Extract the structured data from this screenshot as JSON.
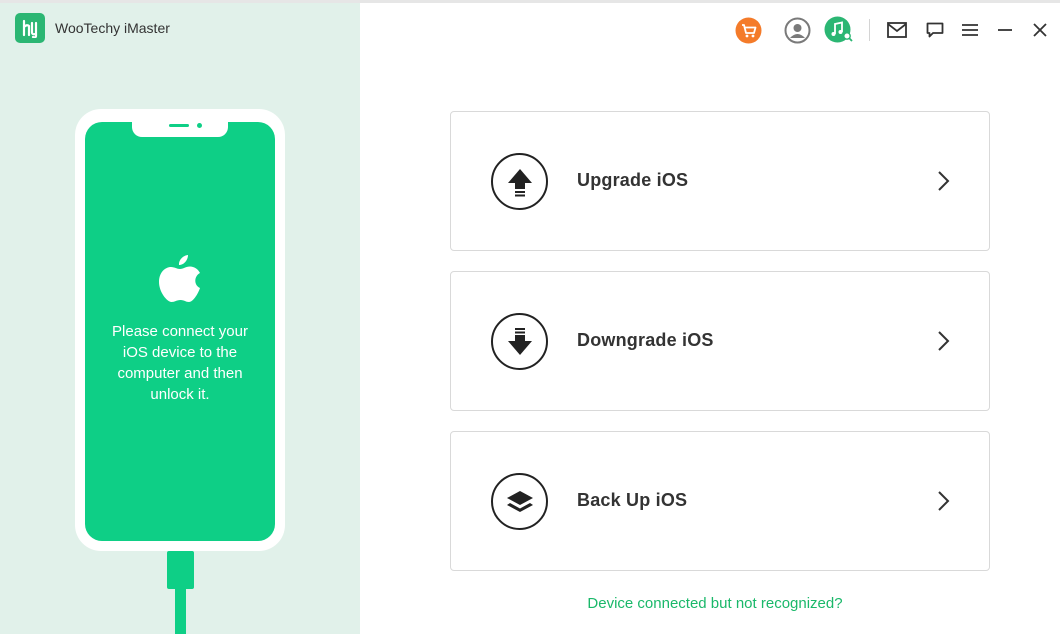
{
  "app": {
    "title": "WooTechy iMaster",
    "logo_icon": "wootechy-logo-icon",
    "accent_color": "#0ecf86"
  },
  "toolbar": {
    "icons": [
      "cart-icon",
      "account-icon",
      "music-search-icon",
      "mail-icon",
      "feedback-icon",
      "menu-icon",
      "minimize-icon",
      "close-icon"
    ],
    "cart_color": "#f47b2a",
    "music_color": "#2bb673"
  },
  "device_panel": {
    "message": "Please connect your iOS device to the computer and then unlock it.",
    "icon": "apple-icon"
  },
  "options": [
    {
      "label": "Upgrade iOS",
      "icon": "upload-arrow-icon"
    },
    {
      "label": "Downgrade iOS",
      "icon": "download-arrow-icon"
    },
    {
      "label": "Back Up iOS",
      "icon": "layers-icon"
    }
  ],
  "help_link": "Device connected but not recognized?"
}
